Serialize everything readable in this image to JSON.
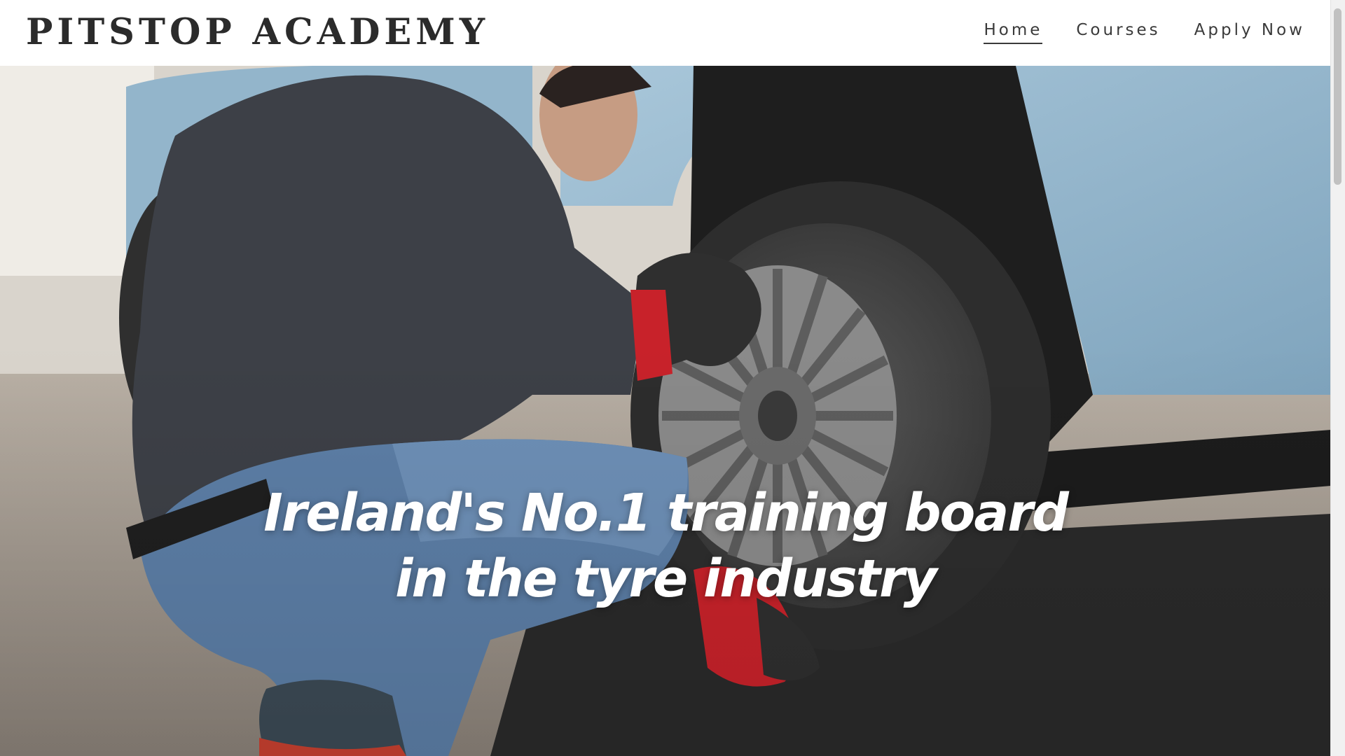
{
  "header": {
    "brand": "PITSTOP ACADEMY",
    "nav": [
      {
        "label": "Home",
        "active": true
      },
      {
        "label": "Courses",
        "active": false
      },
      {
        "label": "Apply Now",
        "active": false
      }
    ]
  },
  "hero": {
    "headline_line1": "Ireland's No.1 training board",
    "headline_line2": "in the tyre industry",
    "image_subject": "mechanic fitting a tyre on a light blue car in a garage"
  },
  "colors": {
    "brand_text": "#2b2b2b",
    "nav_text": "#3a3a3a",
    "car_body": "#8fb3cc",
    "glove": "#c8222a",
    "headline": "#ffffff"
  },
  "icons": {}
}
